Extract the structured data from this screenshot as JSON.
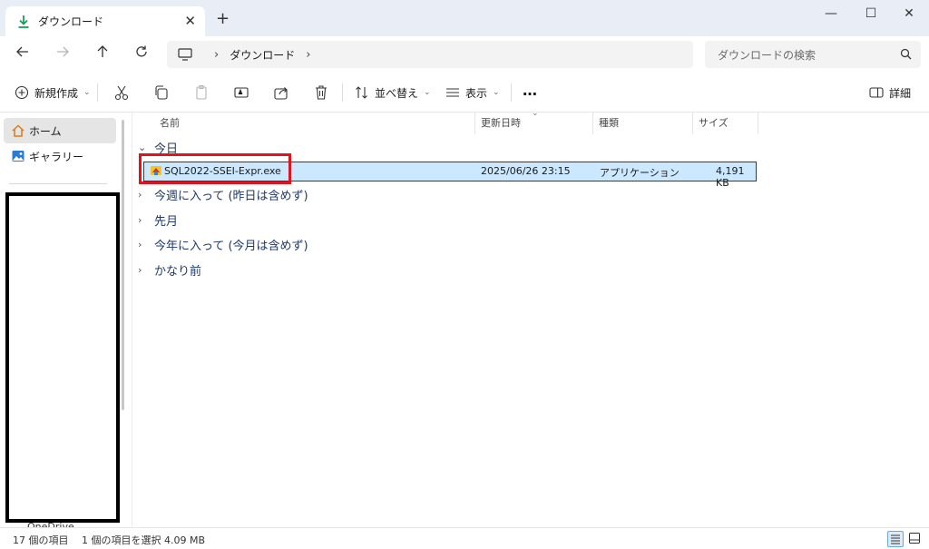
{
  "window": {
    "tab_title": "ダウンロード",
    "close_tab_glyph": "✕",
    "new_tab_glyph": "+",
    "minimize_glyph": "—",
    "maximize_glyph": "☐",
    "close_glyph": "✕"
  },
  "address": {
    "path": [
      "ダウンロード"
    ],
    "search_placeholder": "ダウンロードの検索"
  },
  "toolbar": {
    "new_label": "新規作成",
    "sort_label": "並べ替え",
    "view_label": "表示",
    "more_label": "…",
    "details_label": "詳細"
  },
  "sidebar": {
    "items": [
      {
        "label": "ホーム",
        "icon": "home-icon",
        "selected": true
      },
      {
        "label": "ギャラリー",
        "icon": "gallery-icon",
        "selected": false
      }
    ],
    "partial_label": "OneDrive"
  },
  "columns": [
    "名前",
    "更新日時",
    "種類",
    "サイズ"
  ],
  "groups": [
    {
      "label": "今日",
      "expanded": true
    },
    {
      "label": "今週に入って (昨日は含めず)",
      "expanded": false
    },
    {
      "label": "先月",
      "expanded": false
    },
    {
      "label": "今年に入って (今月は含めず)",
      "expanded": false
    },
    {
      "label": "かなり前",
      "expanded": false
    }
  ],
  "files": [
    {
      "name": "SQL2022-SSEI-Expr.exe",
      "modified": "2025/06/26 23:15",
      "type": "アプリケーション",
      "size": "4,191 KB",
      "selected": true
    }
  ],
  "status": {
    "item_count": "17 個の項目",
    "selection": "1 個の項目を選択  4.09 MB"
  },
  "colors": {
    "accent": "#0067c0",
    "selection": "#cce8ff",
    "highlight_box": "#e0141f",
    "download_icon": "#1a9e5a"
  }
}
